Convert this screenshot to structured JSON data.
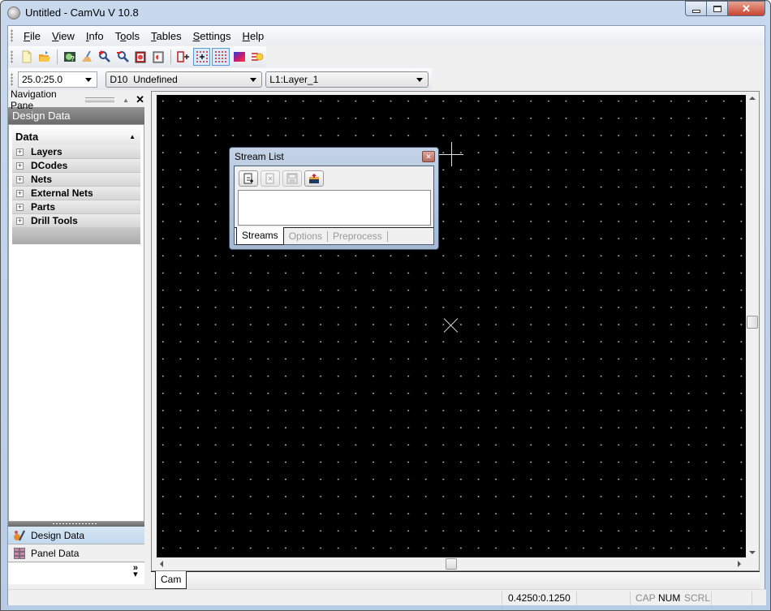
{
  "window": {
    "title": "Untitled - CamVu V 10.8",
    "controls": {
      "minimize": "minimize",
      "maximize": "maximize",
      "close": "✕"
    }
  },
  "menu": [
    {
      "label": "File",
      "accel": "F"
    },
    {
      "label": "View",
      "accel": "V"
    },
    {
      "label": "Info",
      "accel": "I"
    },
    {
      "label": "Tools",
      "accel": "o"
    },
    {
      "label": "Tables",
      "accel": "T"
    },
    {
      "label": "Settings",
      "accel": "S"
    },
    {
      "label": "Help",
      "accel": "H"
    }
  ],
  "toolbar": {
    "buttons": [
      {
        "name": "new-icon"
      },
      {
        "name": "open-icon"
      },
      {
        "name": "separator"
      },
      {
        "name": "view-icon"
      },
      {
        "name": "clear-icon"
      },
      {
        "name": "zoom-in-icon"
      },
      {
        "name": "zoom-out-icon"
      },
      {
        "name": "redraw-icon"
      },
      {
        "name": "redraw-partial-icon"
      },
      {
        "name": "separator"
      },
      {
        "name": "insert-icon"
      },
      {
        "name": "snap-grid-icon",
        "pressed": true
      },
      {
        "name": "grid-icon",
        "pressed": true
      },
      {
        "name": "color-icon"
      },
      {
        "name": "highlight-icon"
      }
    ]
  },
  "combos": {
    "grid": "25.0:25.0",
    "dcode": "D10  Undefined",
    "layer": "L1:Layer_1"
  },
  "nav": {
    "header": "Navigation Pane",
    "title": "Design Data",
    "section": "Data",
    "items": [
      "Layers",
      "DCodes",
      "Nets",
      "External Nets",
      "Parts",
      "Drill Tools"
    ],
    "buttons": [
      {
        "label": "Design Data",
        "active": true
      },
      {
        "label": "Panel Data",
        "active": false
      }
    ],
    "more": "»"
  },
  "stream_list": {
    "title": "Stream List",
    "tools": [
      {
        "name": "add-stream-icon",
        "enabled": true
      },
      {
        "name": "remove-stream-icon",
        "enabled": false
      },
      {
        "name": "save-stream-icon",
        "enabled": false
      },
      {
        "name": "load-stream-icon",
        "enabled": true
      }
    ],
    "tabs": [
      {
        "label": "Streams",
        "active": true
      },
      {
        "label": "Options",
        "active": false
      },
      {
        "label": "Preprocess",
        "active": false
      }
    ]
  },
  "tabs": [
    {
      "label": "Cam",
      "active": true
    }
  ],
  "status": {
    "coords": "0.4250:0.1250",
    "cap": "CAP",
    "num": "NUM",
    "scrl": "SCRL"
  }
}
